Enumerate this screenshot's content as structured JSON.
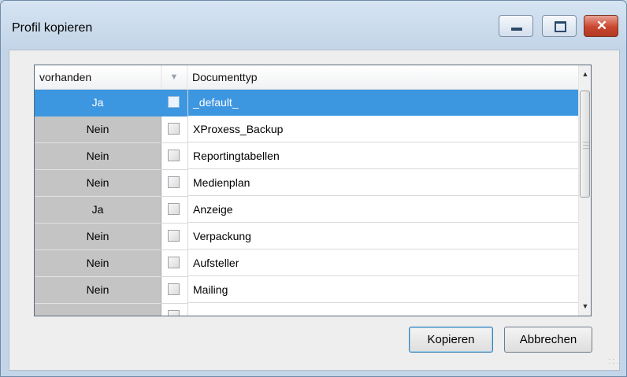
{
  "window": {
    "title": "Profil kopieren"
  },
  "columns": {
    "vorhanden": "vorhanden",
    "filter_glyph": "▼",
    "documenttyp": "Documenttyp"
  },
  "rows": [
    {
      "vorhanden": "Ja",
      "checked": false,
      "documenttyp": "_default_",
      "selected": true
    },
    {
      "vorhanden": "Nein",
      "checked": false,
      "documenttyp": "XProxess_Backup",
      "selected": false
    },
    {
      "vorhanden": "Nein",
      "checked": false,
      "documenttyp": "Reportingtabellen",
      "selected": false
    },
    {
      "vorhanden": "Nein",
      "checked": false,
      "documenttyp": "Medienplan",
      "selected": false
    },
    {
      "vorhanden": "Ja",
      "checked": false,
      "documenttyp": "Anzeige",
      "selected": false
    },
    {
      "vorhanden": "Nein",
      "checked": false,
      "documenttyp": "Verpackung",
      "selected": false
    },
    {
      "vorhanden": "Nein",
      "checked": false,
      "documenttyp": "Aufsteller",
      "selected": false
    },
    {
      "vorhanden": "Nein",
      "checked": false,
      "documenttyp": "Mailing",
      "selected": false
    },
    {
      "vorhanden": "",
      "checked": false,
      "documenttyp": "",
      "selected": false
    }
  ],
  "buttons": {
    "kopieren": "Kopieren",
    "abbrechen": "Abbrechen"
  },
  "titlebar_buttons": {
    "minimize": "minimize-icon",
    "maximize": "maximize-icon",
    "close": "close-icon"
  },
  "colors": {
    "selection": "#3d96e0",
    "close_button": "#c9462f",
    "vorhanden_cell": "#c4c4c4"
  }
}
